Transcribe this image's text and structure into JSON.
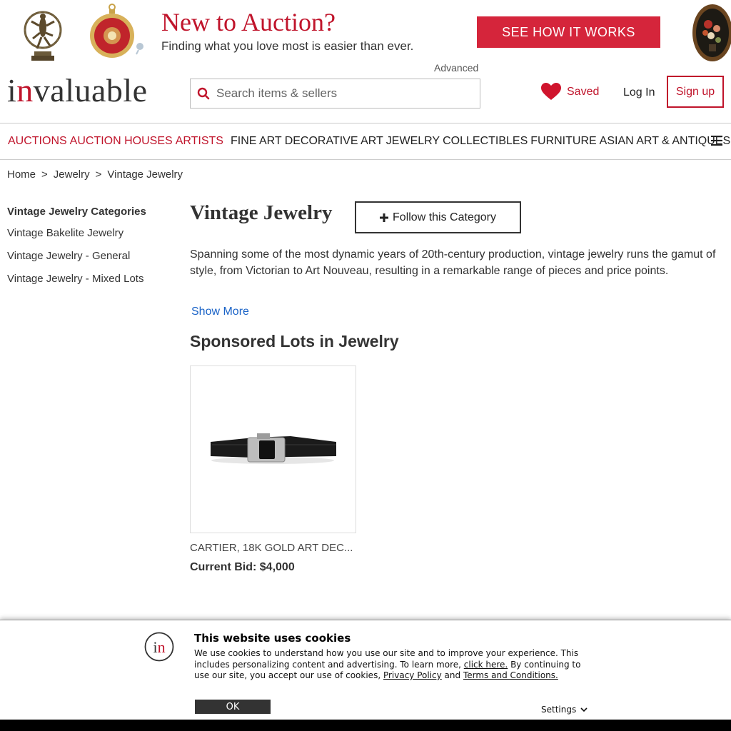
{
  "promo": {
    "title": "New to Auction?",
    "subtitle": "Finding what you love most is easier than ever.",
    "cta_label": "SEE HOW IT WORKS"
  },
  "header": {
    "logo_i": "i",
    "logo_n": "n",
    "logo_rest": "valuable",
    "advanced_label": "Advanced",
    "search_placeholder": "Search items & sellers",
    "saved_label": "Saved",
    "login_label": "Log In",
    "signup_label": "Sign up"
  },
  "nav": {
    "primary": [
      "AUCTIONS",
      "AUCTION HOUSES",
      "ARTISTS"
    ],
    "categories": [
      "FINE ART",
      "DECORATIVE ART",
      "JEWELRY",
      "COLLECTIBLES",
      "FURNITURE",
      "ASIAN ART & ANTIQUES"
    ]
  },
  "breadcrumb": {
    "items": [
      "Home",
      "Jewelry",
      "Vintage Jewelry"
    ],
    "separator": ">"
  },
  "sidebar": {
    "heading": "Vintage Jewelry Categories",
    "links": [
      "Vintage Bakelite Jewelry",
      "Vintage Jewelry - General",
      "Vintage Jewelry - Mixed Lots"
    ]
  },
  "main": {
    "title": "Vintage Jewelry",
    "follow_label": "Follow this Category",
    "description": "Spanning some of the most dynamic years of 20th-century production, vintage jewelry runs the gamut of style, from Victorian to Art Nouveau, resulting in a remarkable range of pieces and price points.",
    "show_more": "Show More",
    "sponsored_heading": "Sponsored Lots in Jewelry"
  },
  "lots": [
    {
      "title": "CARTIER, 18K GOLD ART DEC...",
      "bid_label": "Current Bid:",
      "bid_value": "$4,000"
    }
  ],
  "cookie": {
    "title": "This website uses cookies",
    "text_1": "We use cookies to understand how you use our site and to improve your experience. This includes personalizing content and advertising. To learn more, ",
    "link_click": "click here.",
    "text_2": " By continuing to use our site, you accept our use of cookies, ",
    "link_privacy": "Privacy Policy",
    "text_and": " and ",
    "link_terms": "Terms and Conditions.",
    "ok_label": "OK",
    "settings_label": "Settings"
  },
  "colors": {
    "brand_red": "#c0142b",
    "cta_red": "#d5253b",
    "link_blue": "#1a63c7"
  }
}
